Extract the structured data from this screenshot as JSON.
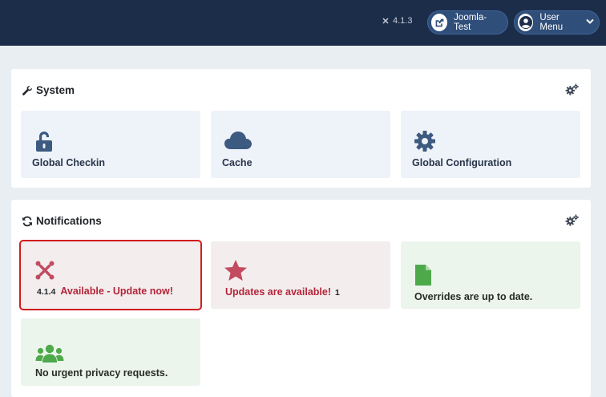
{
  "header": {
    "version": "4.1.3",
    "site_label": "Joomla-Test",
    "user_menu_label": "User Menu"
  },
  "system": {
    "title": "System",
    "tiles": [
      {
        "label": "Global Checkin",
        "icon": "unlock-icon"
      },
      {
        "label": "Cache",
        "icon": "cloud-icon"
      },
      {
        "label": "Global Configuration",
        "icon": "gear-icon"
      }
    ]
  },
  "notifications": {
    "title": "Notifications",
    "joomla_update": {
      "version": "4.1.4",
      "text": "Available - Update now!",
      "icon": "joomla-icon"
    },
    "extension_updates": {
      "text": "Updates are available!",
      "count": "1",
      "icon": "star-icon"
    },
    "overrides": {
      "text": "Overrides are up to date.",
      "icon": "file-icon"
    },
    "privacy": {
      "text": "No urgent privacy requests.",
      "icon": "users-icon"
    }
  },
  "colors": {
    "header_bg": "#1c2d4a",
    "page_bg": "#e9eef2",
    "icon_blue": "#3d5a80",
    "alert_red": "#b4253a",
    "success_green": "#4ea94b",
    "highlight_red": "#d11b1b"
  }
}
